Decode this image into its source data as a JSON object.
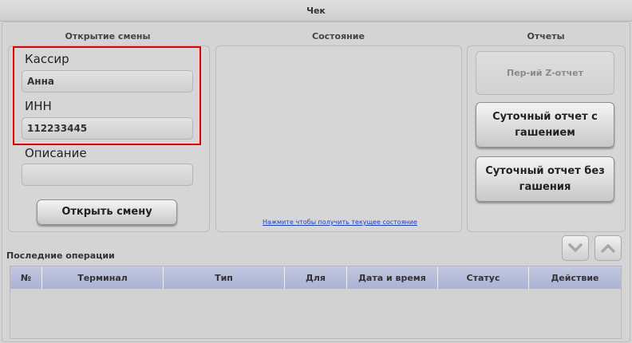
{
  "window": {
    "title": "Чек"
  },
  "sections": {
    "open_shift": "Открытие смены",
    "state": "Состояние",
    "reports": "Отчеты"
  },
  "form": {
    "cashier_label": "Кассир",
    "cashier_value": "Анна",
    "inn_label": "ИНН",
    "inn_value": "112233445",
    "description_label": "Описание",
    "description_value": "",
    "open_shift_button": "Открыть смену"
  },
  "state_panel": {
    "link": "Нажмите чтобы получить текущее состояние"
  },
  "reports": {
    "z_report_button": "Пер-ий Z-отчет",
    "daily_with_clear_button": "Суточный отчет с гашением",
    "daily_without_clear_button": "Суточный отчет без гашения"
  },
  "nav": {
    "down_icon": "chevron-down-icon",
    "up_icon": "chevron-up-icon"
  },
  "operations": {
    "title": "Последние операции",
    "columns": [
      "№",
      "Терминал",
      "Тип",
      "Для",
      "Дата и время",
      "Статус",
      "Действие"
    ],
    "rows": []
  },
  "colors": {
    "header_accent": "#aab3d6",
    "highlight_border": "#e00000",
    "link": "#1a3fbf"
  }
}
